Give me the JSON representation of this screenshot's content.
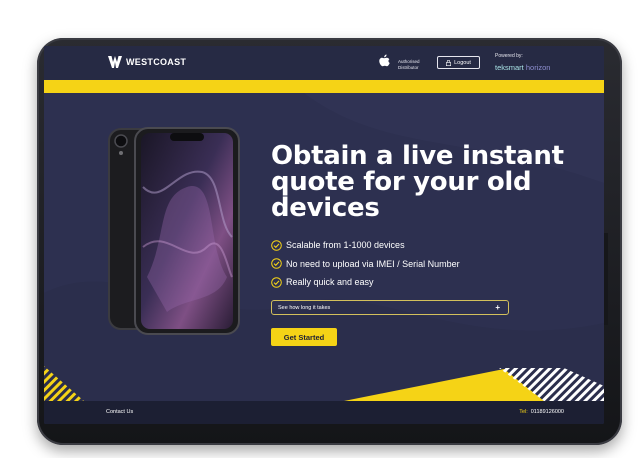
{
  "header": {
    "brand": "WESTCOAST",
    "authorised_line1": "Authorised",
    "authorised_line2": "Distributor",
    "logout_label": "Logout",
    "powered_by": "Powered by:",
    "powered_brand_a": "teksmart",
    "powered_brand_b": " horizon"
  },
  "hero": {
    "headline": "Obtain a live instant quote for your old devices",
    "features": [
      "Scalable from 1-1000 devices",
      "No need to upload via IMEI / Serial Number",
      "Really quick and easy"
    ],
    "howlong_label": "See how long it takes",
    "howlong_toggle": "+",
    "cta_label": "Get Started"
  },
  "footer": {
    "contact": "Contact Us",
    "tel_label": "Tel:",
    "tel_number": "01189126000"
  },
  "colors": {
    "accent": "#f5d316",
    "header_bg": "#262a44",
    "page_bg": "#2d3050",
    "footer_bg": "#1c1f33"
  },
  "icons": [
    "westcoast-logo-icon",
    "apple-icon",
    "lock-icon",
    "check-circle-icon",
    "plus-icon"
  ]
}
